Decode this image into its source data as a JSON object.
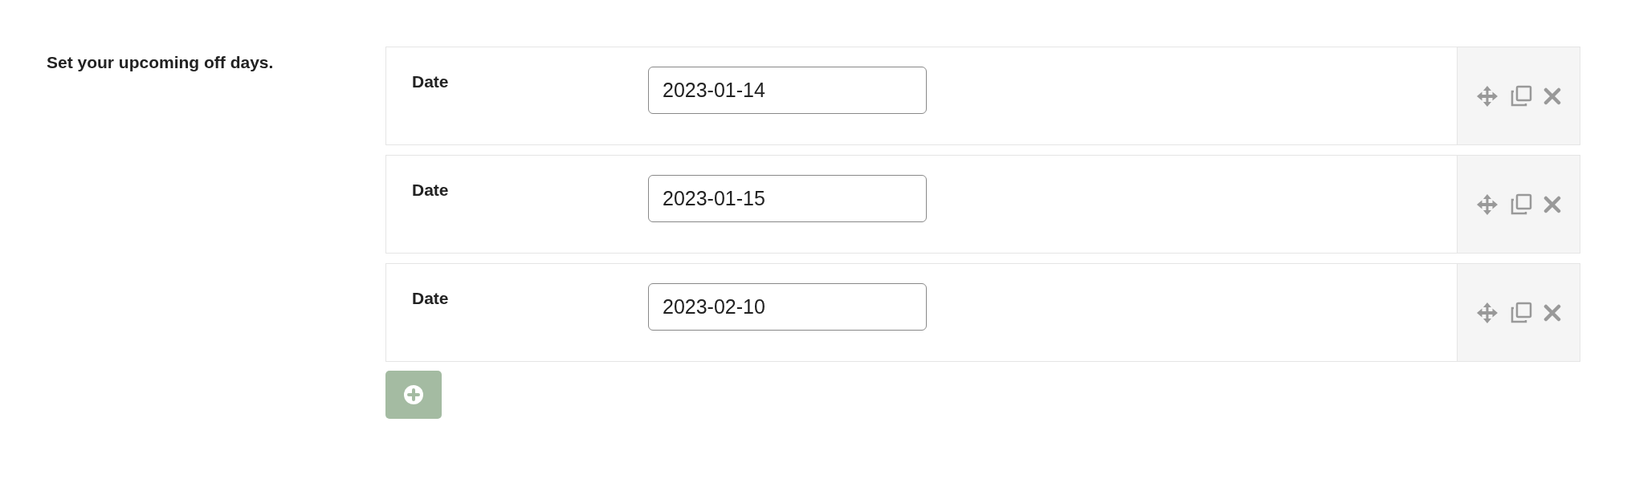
{
  "intro": "Set your upcoming off days.",
  "rows": [
    {
      "label": "Date",
      "value": "2023-01-14"
    },
    {
      "label": "Date",
      "value": "2023-01-15"
    },
    {
      "label": "Date",
      "value": "2023-02-10"
    }
  ]
}
